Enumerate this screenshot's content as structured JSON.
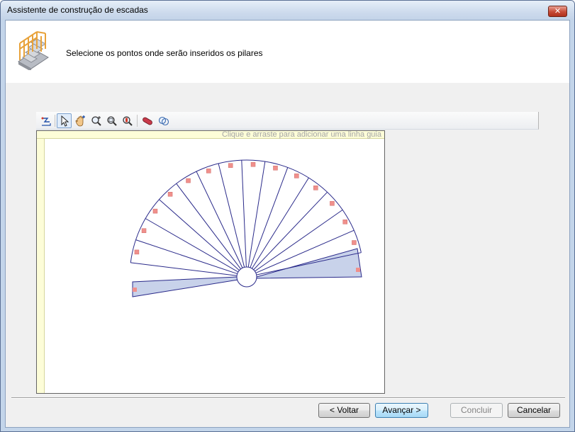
{
  "window": {
    "title": "Assistente de construção de escadas",
    "close_label": "✕"
  },
  "header": {
    "instruction": "Selecione os pontos onde serão inseridos os pilares",
    "icon": "staircase-icon"
  },
  "toolbar": {
    "buttons": [
      {
        "name": "snap-tool-icon"
      },
      {
        "name": "select-pointer-icon",
        "active": true
      },
      {
        "name": "pan-hand-icon"
      },
      {
        "name": "zoom-in-icon"
      },
      {
        "name": "zoom-window-icon"
      },
      {
        "name": "zoom-extents-icon"
      },
      {
        "name": "eraser-icon"
      },
      {
        "name": "pillar-tool-icon"
      }
    ]
  },
  "canvas": {
    "ruler_hint": "Clique e arraste para adicionar uma linha guia"
  },
  "footer": {
    "back_label": "< Voltar",
    "next_label": "Avançar >",
    "finish_label": "Concluir",
    "cancel_label": "Cancelar"
  },
  "colors": {
    "stair_outline": "#2a2a8a",
    "landing_fill": "#c8d2ea",
    "pillar_marker": "#f0908c",
    "ruler_bg": "#fdfdd8"
  }
}
